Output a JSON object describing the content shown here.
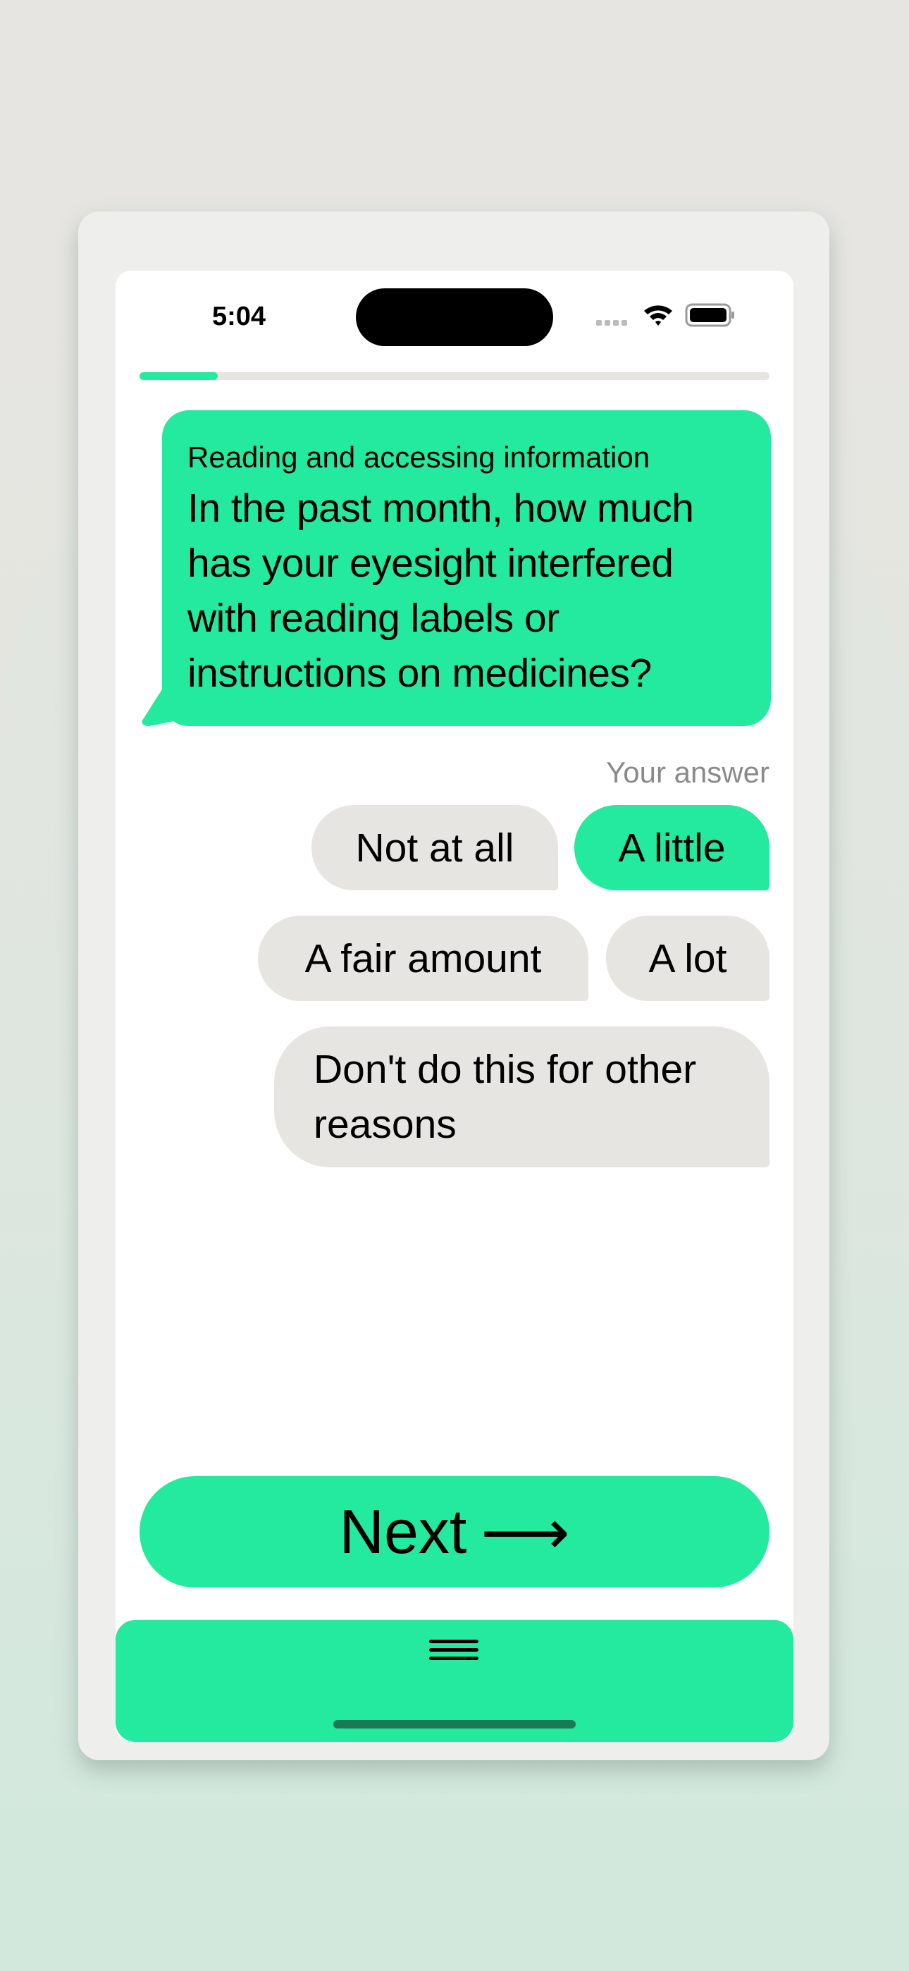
{
  "status_bar": {
    "time": "5:04",
    "icons": [
      "signal-icon",
      "wifi-icon",
      "battery-icon"
    ]
  },
  "progress": {
    "fraction": 0.124
  },
  "question": {
    "category": "Reading and accessing information",
    "text": "In the past month, how much has your eyesight interfered with reading labels or instructions on medicines?"
  },
  "answer_label": "Your answer",
  "options": [
    {
      "label": "Not at all",
      "selected": false
    },
    {
      "label": "A little",
      "selected": true
    },
    {
      "label": "A fair amount",
      "selected": false
    },
    {
      "label": "A lot",
      "selected": false
    },
    {
      "label": "Don't do this for other reasons",
      "selected": false
    }
  ],
  "next_button": {
    "label": "Next",
    "icon": "arrow-right-icon",
    "arrow": "⟶"
  },
  "bottom_bar": {
    "icon": "menu-icon"
  },
  "colors": {
    "accent": "#23ea9f",
    "option_bg": "#e6e5e1",
    "muted_text": "#8a8a8a"
  }
}
